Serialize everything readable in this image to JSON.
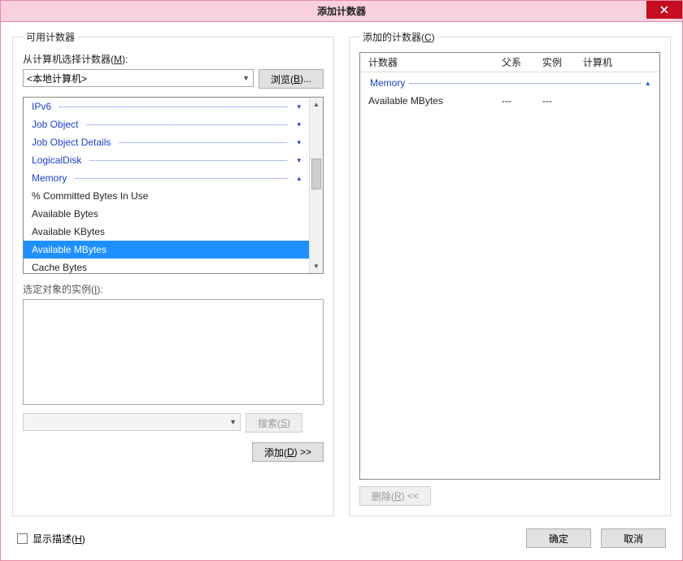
{
  "window": {
    "title": "添加计数器"
  },
  "left": {
    "legend": "可用计数器",
    "select_label_prefix": "从计算机选择计数器(",
    "select_label_key": "M",
    "select_label_suffix": "):",
    "computer_value": "<本地计算机>",
    "browse_prefix": "浏览(",
    "browse_key": "B",
    "browse_suffix": ")...",
    "categories": [
      {
        "name": "IPv6",
        "expanded": false
      },
      {
        "name": "Job Object",
        "expanded": false
      },
      {
        "name": "Job Object Details",
        "expanded": false
      },
      {
        "name": "LogicalDisk",
        "expanded": false
      },
      {
        "name": "Memory",
        "expanded": true,
        "items": [
          {
            "name": "% Committed Bytes In Use",
            "selected": false
          },
          {
            "name": "Available Bytes",
            "selected": false
          },
          {
            "name": "Available KBytes",
            "selected": false
          },
          {
            "name": "Available MBytes",
            "selected": true
          },
          {
            "name": "Cache Bytes",
            "selected": false
          }
        ]
      }
    ],
    "instances_prefix": "选定对象的实例(",
    "instances_key": "I",
    "instances_suffix": "):",
    "search_prefix": "搜索(",
    "search_key": "S",
    "search_suffix": ")",
    "add_prefix": "添加(",
    "add_key": "D",
    "add_suffix": ") >>"
  },
  "right": {
    "legend_prefix": "添加的计数器(",
    "legend_key": "C",
    "legend_suffix": ")",
    "columns": {
      "c1": "计数器",
      "c2": "父系",
      "c3": "实例",
      "c4": "计算机"
    },
    "group": "Memory",
    "rows": [
      {
        "counter": "Available MBytes",
        "parent": "---",
        "instance": "---",
        "computer": ""
      }
    ],
    "remove_prefix": "删除(",
    "remove_key": "R",
    "remove_suffix": ") <<"
  },
  "footer": {
    "show_desc_prefix": "显示描述(",
    "show_desc_key": "H",
    "show_desc_suffix": ")",
    "ok": "确定",
    "cancel": "取消"
  }
}
